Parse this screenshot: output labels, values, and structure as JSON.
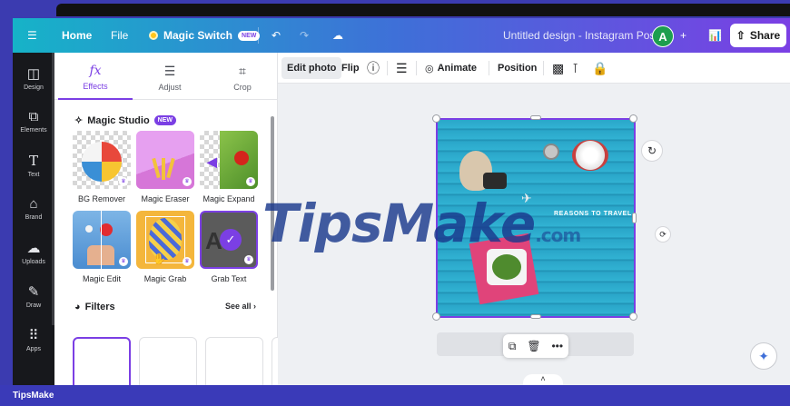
{
  "topbar": {
    "home": "Home",
    "file": "File",
    "magic_switch": "Magic Switch",
    "new_badge": "NEW",
    "document_title": "Untitled design - Instagram Post",
    "avatar_initial": "A",
    "share": "Share",
    "gradient_colors": [
      "#16b3c8",
      "#3f6fd8",
      "#7b3fe4"
    ]
  },
  "rail": {
    "items": [
      {
        "label": "Design",
        "icon": "layout-icon"
      },
      {
        "label": "Elements",
        "icon": "shapes-icon"
      },
      {
        "label": "Text",
        "icon": "text-icon"
      },
      {
        "label": "Brand",
        "icon": "briefcase-icon"
      },
      {
        "label": "Uploads",
        "icon": "cloud-upload-icon"
      },
      {
        "label": "Draw",
        "icon": "pen-icon"
      },
      {
        "label": "Apps",
        "icon": "grid-icon"
      }
    ]
  },
  "panel": {
    "tabs": [
      {
        "label": "Effects",
        "icon": "fx-icon"
      },
      {
        "label": "Adjust",
        "icon": "sliders-icon"
      },
      {
        "label": "Crop",
        "icon": "crop-icon"
      }
    ],
    "magic_studio": {
      "title": "Magic Studio",
      "badge": "NEW",
      "tools": [
        "BG Remover",
        "Magic Eraser",
        "Magic Expand",
        "Magic Edit",
        "Magic Grab",
        "Grab Text"
      ]
    },
    "filters": {
      "title": "Filters",
      "see_all": "See all"
    }
  },
  "context_toolbar": {
    "edit_photo": "Edit photo",
    "flip": "Flip",
    "animate": "Animate",
    "position": "Position"
  },
  "canvas": {
    "design_text": "REASONS TO TRAVEL",
    "accent": "#7b3fe4"
  },
  "watermark": {
    "brand": "TipsMake",
    "suffix": ".com"
  },
  "footer": {
    "label": "TipsMake"
  }
}
